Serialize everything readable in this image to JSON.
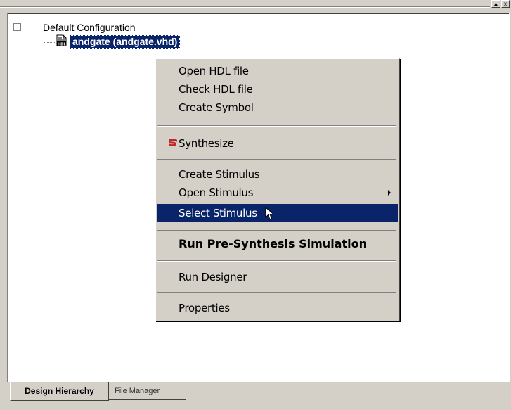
{
  "window_buttons": {
    "scroll_up": "▲",
    "close": "x"
  },
  "tree": {
    "root_label": "Default Configuration",
    "child_label": "andgate (andgate.vhd)",
    "child_icon": "hdl-file-icon"
  },
  "context_menu": {
    "items": [
      {
        "label": "Open HDL file"
      },
      {
        "label": "Check HDL file"
      },
      {
        "label": "Create Symbol"
      },
      {
        "label": "Synthesize",
        "icon": "synthesize-icon"
      },
      {
        "label": "Create Stimulus"
      },
      {
        "label": "Open Stimulus",
        "has_submenu": true
      },
      {
        "label": "Select Stimulus",
        "highlighted": true
      },
      {
        "label": "Run Pre-Synthesis Simulation",
        "bold": true
      },
      {
        "label": "Run Designer"
      },
      {
        "label": "Properties"
      }
    ]
  },
  "tabs": [
    {
      "label": "Design Hierarchy",
      "active": true
    },
    {
      "label": "File Manager",
      "active": false
    }
  ],
  "colors": {
    "highlight": "#0a246a",
    "face": "#d4d0c8",
    "synthesize_icon": "#c0262c"
  }
}
